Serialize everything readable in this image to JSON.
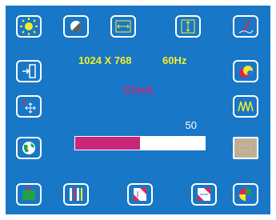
{
  "osd": {
    "resolution": "1024 X 768",
    "refresh_rate": "60Hz",
    "menu_title": "Clock",
    "value_label": "50",
    "slider_fraction": 0.5,
    "colors": {
      "background": "#1877c6",
      "accent": "#c8277b",
      "info_text": "#f7ee2a",
      "selected": "#b9b2a6"
    }
  }
}
